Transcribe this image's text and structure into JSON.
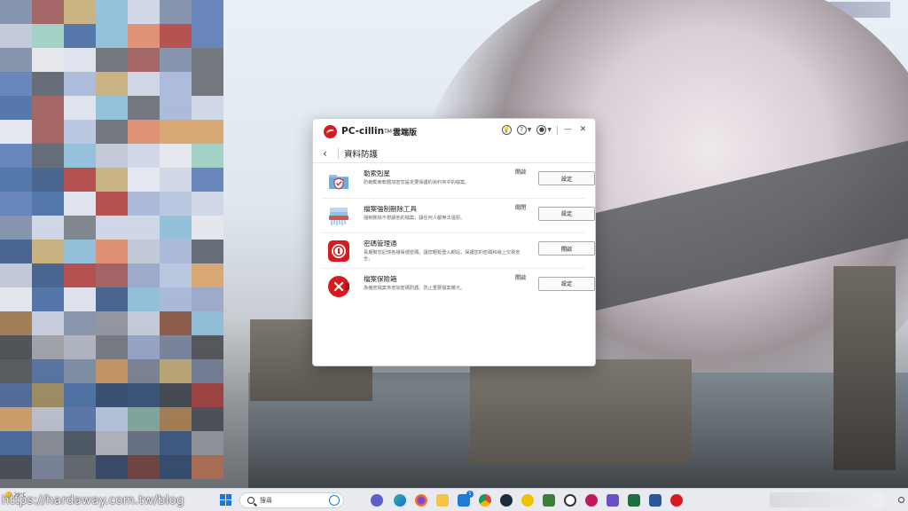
{
  "app": {
    "brand_name": "PC-cillin",
    "brand_tm": "TM",
    "brand_edition": "雲端版",
    "page_title": "資料防護",
    "accent_color": "#d71920",
    "features": [
      {
        "icon": "folder-shield-icon",
        "name": "勒索剋星",
        "description": "防範勒索軟體加密您設定要保護的資料夾中的檔案。",
        "status": "開啟",
        "button_label": "設定"
      },
      {
        "icon": "file-shredder-icon",
        "name": "檔案強制刪除工具",
        "description": "強制刪除不想讓他的檔案，讓任何人都無法還原。",
        "status": "關閉",
        "button_label": "設定"
      },
      {
        "icon": "password-manager-icon",
        "name": "密碼管理通",
        "description": "長期幫您記憶各組帳號密碼，讓您輕鬆登入網站，保護您的密碼和線上交易安全。",
        "status": "",
        "button_label": "開啟"
      },
      {
        "icon": "secure-vault-icon",
        "name": "檔案保險箱",
        "description": "為機密檔案夾增加密碼防護，防止重要檔案曝光。",
        "status": "開啟",
        "button_label": "設定"
      }
    ]
  },
  "taskbar": {
    "weather_temp": "29°C",
    "search_placeholder": "搜尋",
    "notification_count": "1",
    "watermark": "https://hardaway.com.tw/blog"
  }
}
